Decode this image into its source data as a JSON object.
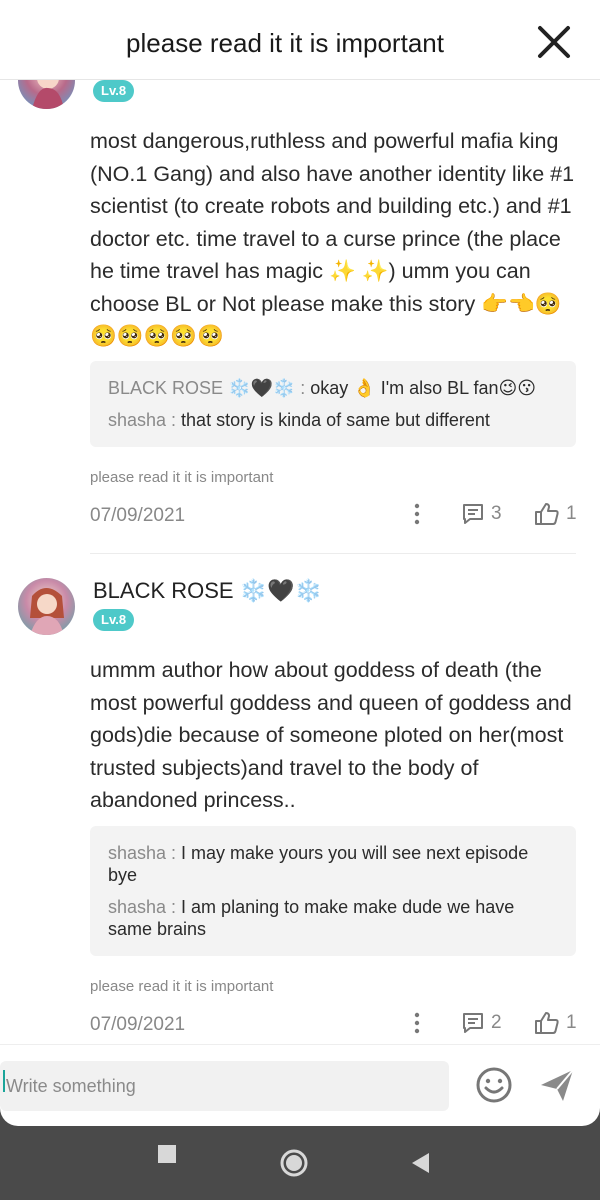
{
  "header": {
    "title": "please read it it is important"
  },
  "comments": [
    {
      "level": "Lv.8",
      "body": "most dangerous,ruthless and powerful mafia king (NO.1 Gang) and also have another identity like #1 scientist (to create robots and building etc.) and #1 doctor etc. time travel to a curse prince (the place he time travel has magic ✨ ✨) umm you can choose BL or Not please make this story 👉👈🥺🥺🥺🥺🥺🥺",
      "replies": [
        {
          "name": "BLACK ROSE ❄️🖤❄️ : ",
          "text": "okay 👌 I'm also BL fan😉😗"
        },
        {
          "name": "shasha : ",
          "text": "that story is kinda of same but different"
        }
      ],
      "source": "please read it it is important",
      "date": "07/09/2021",
      "comment_count": "3",
      "like_count": "1"
    },
    {
      "username": "BLACK ROSE",
      "username_emoji": "❄️🖤❄️",
      "level": "Lv.8",
      "body": "ummm author how about goddess of death (the most powerful goddess and queen of goddess and gods)die because of someone ploted on her(most trusted subjects)and travel to the body of abandoned princess..",
      "replies": [
        {
          "name": "shasha : ",
          "text": "I may make yours you will see next episode bye"
        },
        {
          "name": "shasha : ",
          "text": "I am planing to make make dude we have same brains"
        }
      ],
      "source": "please read it it is important",
      "date": "07/09/2021",
      "comment_count": "2",
      "like_count": "1"
    }
  ],
  "composer": {
    "placeholder": "Write something"
  },
  "icons": {
    "close": "close-icon",
    "more": "more-vertical-icon",
    "comment": "comment-icon",
    "like": "thumbs-up-icon",
    "emoji": "smiley-icon",
    "send": "send-icon"
  },
  "colors": {
    "level_badge": "#4ec9c9",
    "navbar": "#4a4a4a",
    "reply_bg": "#f3f3f3"
  }
}
